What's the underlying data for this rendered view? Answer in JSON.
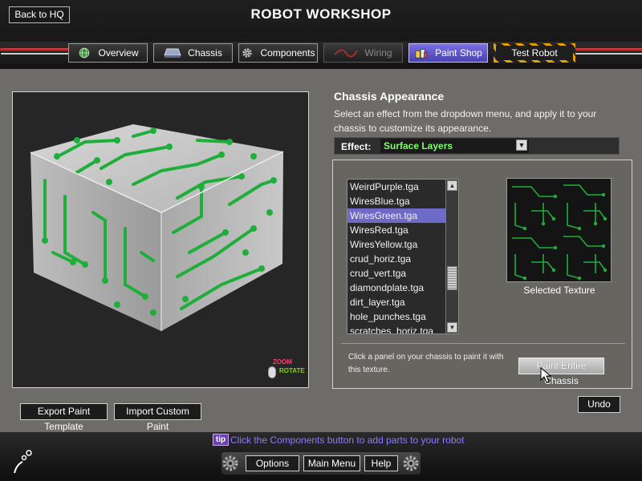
{
  "header": {
    "back_label": "Back to HQ",
    "title": "ROBOT WORKSHOP"
  },
  "tabs": [
    {
      "label": "Overview",
      "icon": "globe-icon",
      "state": "normal"
    },
    {
      "label": "Chassis",
      "icon": "chassis-icon",
      "state": "normal"
    },
    {
      "label": "Components",
      "icon": "gear-icon",
      "state": "normal"
    },
    {
      "label": "Wiring",
      "icon": "wire-icon",
      "state": "disabled"
    },
    {
      "label": "Paint Shop",
      "icon": "paint-cans-icon",
      "state": "active"
    },
    {
      "label": "Test Robot",
      "icon": "",
      "state": "hazard"
    }
  ],
  "viewport": {
    "zoom_hint": "ZOOM",
    "rotate_hint": "ROTATE"
  },
  "appearance": {
    "title": "Chassis Appearance",
    "description": "Select an effect from the dropdown menu, and apply it to your chassis to customize its appearance.",
    "effect_label": "Effect:",
    "effect_value": "Surface Layers",
    "textures": [
      "WeirdPurple.tga",
      "WiresBlue.tga",
      "WiresGreen.tga",
      "WiresRed.tga",
      "WiresYellow.tga",
      "crud_horiz.tga",
      "crud_vert.tga",
      "diamondplate.tga",
      "dirt_layer.tga",
      "hole_punches.tga",
      "scratches_horiz.tga"
    ],
    "selected_texture": "WiresGreen.tga",
    "preview_label": "Selected Texture",
    "paint_hint": "Click a panel on your chassis to paint it with this texture.",
    "paint_all_label": "Paint Entire Chassis"
  },
  "actions": {
    "undo_label": "Undo",
    "export_label": "Export Paint Template",
    "import_label": "Import Custom Paint"
  },
  "footer": {
    "tip_badge": "tip",
    "tip_text": "Click the Components button to add parts to your robot",
    "options_label": "Options",
    "main_menu_label": "Main Menu",
    "help_label": "Help"
  },
  "colors": {
    "accent_purple": "#6e6ac8",
    "texture_green": "#1fae3a",
    "effect_text": "#7eff6a",
    "tip_text": "#8c7cff"
  }
}
